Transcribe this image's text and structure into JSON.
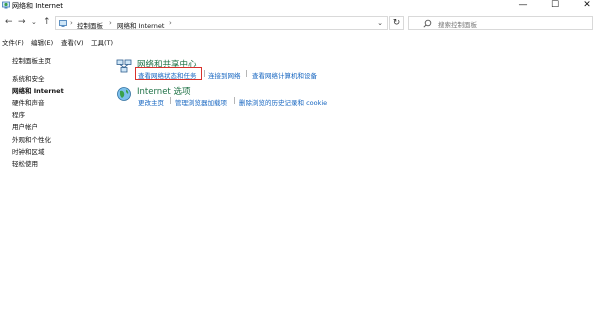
{
  "window": {
    "title": "网络和 Internet"
  },
  "controls": {
    "minimize": "—",
    "maximize": "☐",
    "close": "✕"
  },
  "nav": {
    "back": "←",
    "forward": "→",
    "recent": "⌄",
    "up": "↑"
  },
  "address": {
    "crumb1": "控制面板",
    "crumb2": "网络和 Internet",
    "sep": "›",
    "dropdown": "⌄",
    "refresh": "↻"
  },
  "search": {
    "placeholder": "搜索控制面板"
  },
  "menu": {
    "file": "文件(F)",
    "edit": "编辑(E)",
    "view": "查看(V)",
    "tools": "工具(T)"
  },
  "sidebar": {
    "items": [
      {
        "label": "控制面板主页"
      },
      {
        "label": "系统和安全"
      },
      {
        "label": "网络和 Internet"
      },
      {
        "label": "硬件和声音"
      },
      {
        "label": "程序"
      },
      {
        "label": "用户帐户"
      },
      {
        "label": "外观和个性化"
      },
      {
        "label": "时钟和区域"
      },
      {
        "label": "轻松使用"
      }
    ]
  },
  "categories": {
    "network_center": {
      "title": "网络和共享中心",
      "links": [
        "查看网络状态和任务",
        "连接到网络",
        "查看网络计算机和设备"
      ]
    },
    "internet_options": {
      "title": "Internet 选项",
      "links": [
        "更改主页",
        "管理浏览器加载项",
        "删除浏览的历史记录和 cookie"
      ]
    }
  },
  "colors": {
    "link": "#1565c0",
    "category_title": "#1e7145",
    "highlight": "#d9312b"
  },
  "icons": {
    "title": "control-panel-network-icon",
    "network_center": "network-sharing-center-icon",
    "internet_options": "internet-options-icon",
    "search": "search-icon"
  }
}
